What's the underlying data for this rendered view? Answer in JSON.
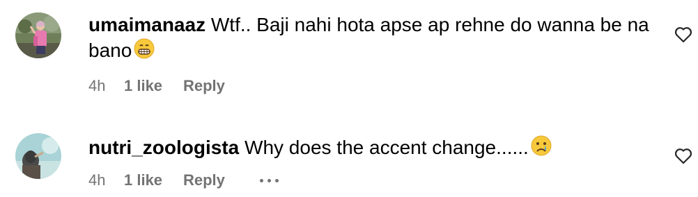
{
  "comments": [
    {
      "username": "umaimanaaz",
      "text": "Wtf.. Baji nahi hota apse ap rehne do wanna be na bano",
      "emoji": "grinning-face-icon",
      "time": "4h",
      "likes": "1 like",
      "reply_label": "Reply",
      "avatar": "avatar-woman-pink-dress",
      "like_icon": "heart-outline-icon"
    },
    {
      "username": "nutri_zoologista",
      "text": "Why does the accent change......",
      "emoji": "crying-face-icon",
      "time": "4h",
      "likes": "1 like",
      "reply_label": "Reply",
      "avatar": "avatar-hijab-teal",
      "like_icon": "heart-outline-icon",
      "more_icon": "ellipsis-icon"
    }
  ]
}
